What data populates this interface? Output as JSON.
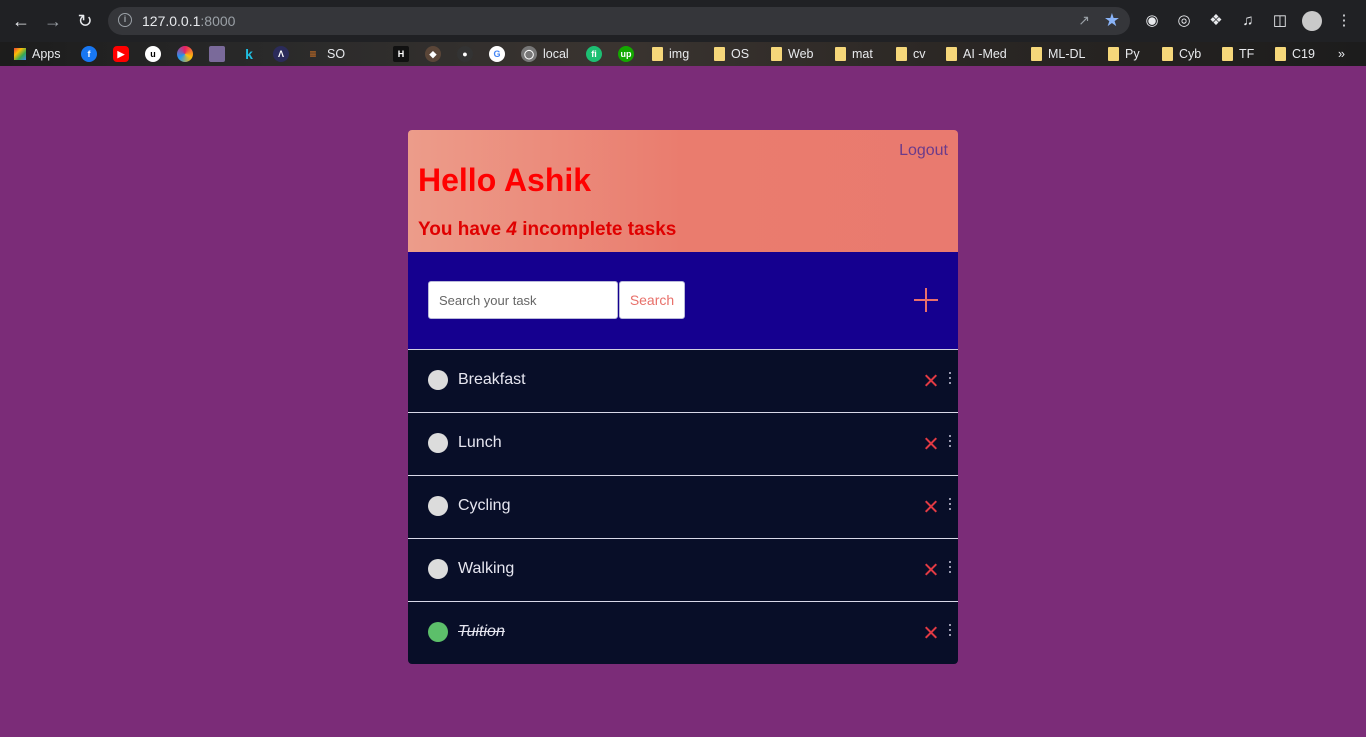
{
  "browser": {
    "url_host": "127.0.0.1",
    "url_port": ":8000",
    "bookmarks": [
      {
        "label": "Apps",
        "icon": "apps-grid-icon"
      },
      {
        "label": "",
        "icon": "facebook-icon"
      },
      {
        "label": "",
        "icon": "youtube-icon"
      },
      {
        "label": "",
        "icon": "udemy-icon"
      },
      {
        "label": "",
        "icon": "swirl-icon"
      },
      {
        "label": "",
        "icon": "image-icon"
      },
      {
        "label": "",
        "icon": "k-icon"
      },
      {
        "label": "",
        "icon": "code-icon"
      },
      {
        "label": "SO",
        "icon": "stackoverflow-icon"
      },
      {
        "label": "",
        "icon": "hackerrank-icon"
      },
      {
        "label": "",
        "icon": "codechef-icon"
      },
      {
        "label": "",
        "icon": "github-icon"
      },
      {
        "label": "",
        "icon": "google-icon"
      },
      {
        "label": "local",
        "icon": "globe-icon"
      },
      {
        "label": "",
        "icon": "fiverr-icon"
      },
      {
        "label": "",
        "icon": "upwork-icon"
      },
      {
        "label": "img",
        "icon": "folder-icon"
      },
      {
        "label": "OS",
        "icon": "folder-icon"
      },
      {
        "label": "Web",
        "icon": "folder-icon"
      },
      {
        "label": "mat",
        "icon": "folder-icon"
      },
      {
        "label": "cv",
        "icon": "folder-icon"
      },
      {
        "label": "AI -Med",
        "icon": "folder-icon"
      },
      {
        "label": "ML-DL",
        "icon": "folder-icon"
      },
      {
        "label": "Py",
        "icon": "folder-icon"
      },
      {
        "label": "Cyb",
        "icon": "folder-icon"
      },
      {
        "label": "TF",
        "icon": "folder-icon"
      },
      {
        "label": "C19",
        "icon": "folder-icon"
      }
    ],
    "more_label": "»"
  },
  "header": {
    "logout_label": "Logout",
    "greeting": "Hello Ashik",
    "incomplete_prefix": "You have ",
    "incomplete_count": "4",
    "incomplete_suffix": " incomplete tasks",
    "colors": {
      "greeting": "#ff0000",
      "background_start": "#ec9c8a",
      "background_end": "#e97a6f"
    }
  },
  "search": {
    "placeholder": "Search your task",
    "value": "",
    "button_label": "Search",
    "add_icon": "plus-icon",
    "background": "#15008f"
  },
  "tasks": [
    {
      "title": "Breakfast",
      "complete": false
    },
    {
      "title": "Lunch",
      "complete": false
    },
    {
      "title": "Cycling",
      "complete": false
    },
    {
      "title": "Walking",
      "complete": false
    },
    {
      "title": "Tuition",
      "complete": true
    }
  ],
  "colors": {
    "page_background": "#7b2c78",
    "task_background": "#080e28",
    "complete_indicator": "#5cbf6a",
    "incomplete_indicator": "#dcdcdc",
    "delete_icon": "#e23a44"
  }
}
